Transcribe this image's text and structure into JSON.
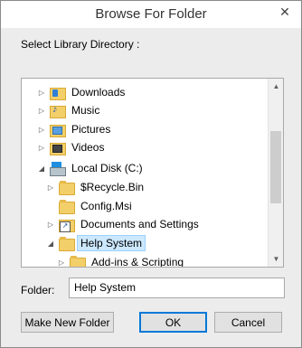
{
  "window": {
    "title": "Browse For Folder",
    "close_symbol": "✕"
  },
  "instruction": "Select Library Directory :",
  "tree": {
    "nodes": [
      {
        "label": "Downloads",
        "icon": "downloads-folder-icon",
        "expander": "collapsed"
      },
      {
        "label": "Music",
        "icon": "music-folder-icon",
        "expander": "collapsed"
      },
      {
        "label": "Pictures",
        "icon": "pictures-folder-icon",
        "expander": "collapsed"
      },
      {
        "label": "Videos",
        "icon": "videos-folder-icon",
        "expander": "collapsed"
      },
      {
        "label": "Local Disk (C:)",
        "icon": "local-disk-icon",
        "expander": "expanded"
      },
      {
        "label": "$Recycle.Bin",
        "icon": "folder-icon",
        "expander": "collapsed"
      },
      {
        "label": "Config.Msi",
        "icon": "folder-icon",
        "expander": "none"
      },
      {
        "label": "Documents and Settings",
        "icon": "shortcut-folder-icon",
        "expander": "collapsed"
      },
      {
        "label": "Help System",
        "icon": "folder-icon",
        "expander": "expanded",
        "selected": true
      },
      {
        "label": "Add-ins & Scripting",
        "icon": "folder-icon",
        "expander": "collapsed"
      }
    ],
    "expand_symbol": "▷",
    "collapse_symbol": "◢",
    "scroll_up_symbol": "▲",
    "scroll_down_symbol": "▼"
  },
  "folder": {
    "label": "Folder:",
    "value": "Help System"
  },
  "buttons": {
    "new_folder": "Make New Folder",
    "ok": "OK",
    "cancel": "Cancel"
  },
  "colors": {
    "selection": "#cce8ff",
    "selection_border": "#99d1ff",
    "default_button_border": "#0078d7"
  }
}
